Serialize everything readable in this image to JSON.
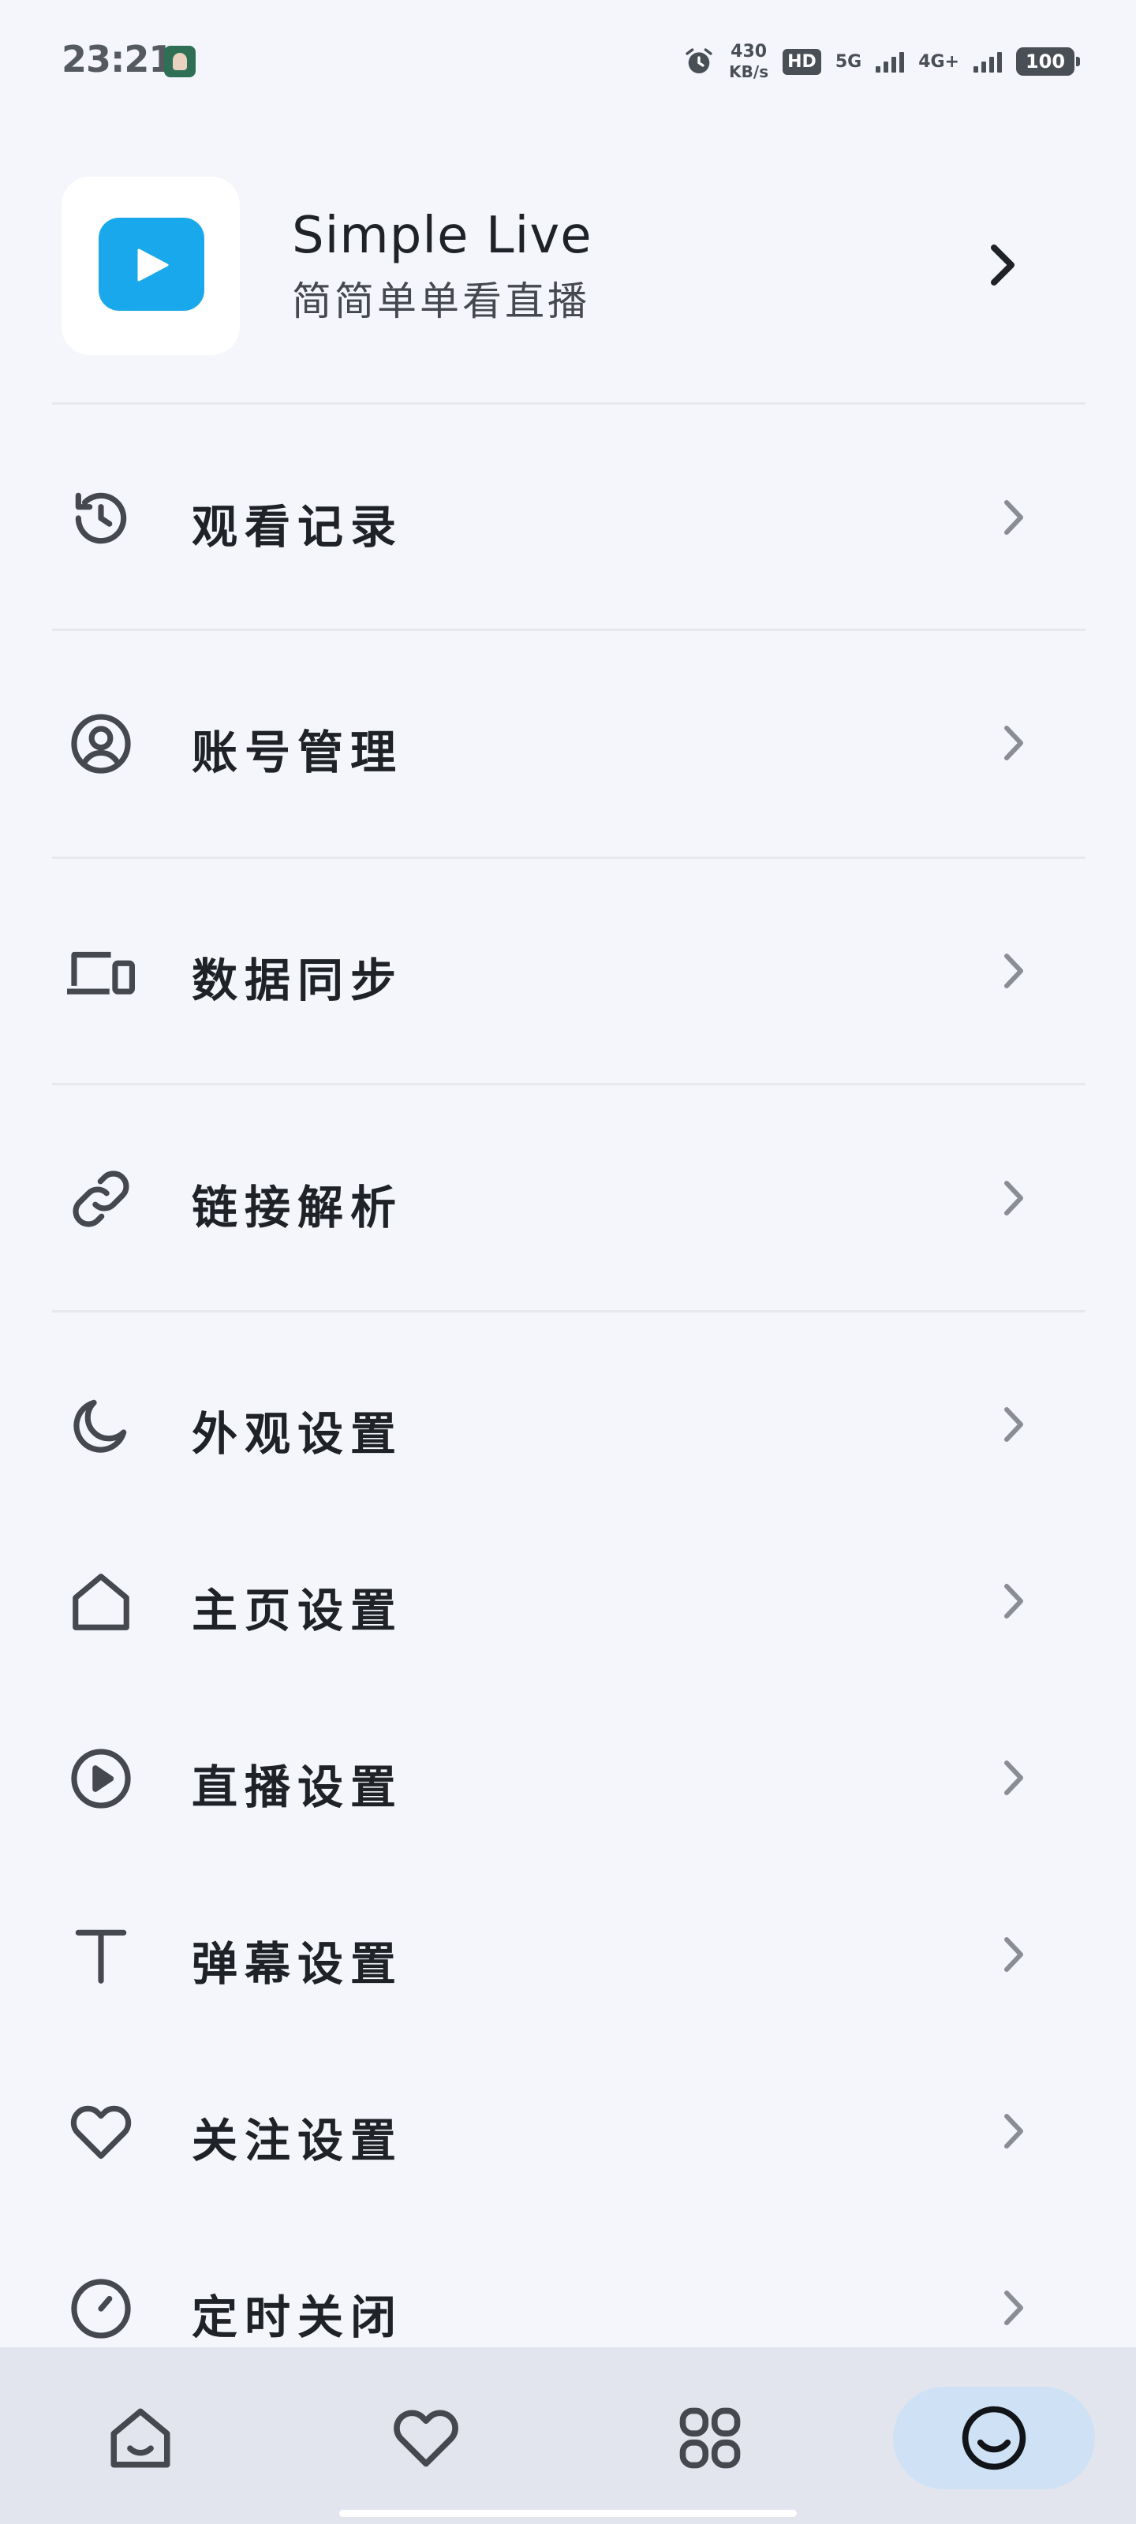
{
  "status_bar": {
    "time": "23:21",
    "net_speed_value": "430",
    "net_speed_unit": "KB/s",
    "hd_badge": "HD",
    "network_1": "5G",
    "network_2": "4G+",
    "battery": "100"
  },
  "app": {
    "name": "Simple Live",
    "subtitle": "简简单单看直播",
    "logo_color": "#1aa8ec"
  },
  "menu": [
    {
      "label": "观看记录",
      "icon": "history-icon"
    },
    {
      "label": "账号管理",
      "icon": "account-circle-icon"
    },
    {
      "label": "数据同步",
      "icon": "devices-icon"
    },
    {
      "label": "链接解析",
      "icon": "link-icon"
    },
    {
      "label": "外观设置",
      "icon": "moon-icon"
    },
    {
      "label": "主页设置",
      "icon": "home-icon"
    },
    {
      "label": "直播设置",
      "icon": "play-circle-icon"
    },
    {
      "label": "弹幕设置",
      "icon": "text-icon"
    },
    {
      "label": "关注设置",
      "icon": "heart-icon"
    },
    {
      "label": "定时关闭",
      "icon": "timer-icon"
    }
  ],
  "bottom_nav": [
    {
      "name": "home",
      "icon": "home-smile-icon",
      "active": false
    },
    {
      "name": "follow",
      "icon": "heart-icon",
      "active": false
    },
    {
      "name": "categories",
      "icon": "grid-icon",
      "active": false
    },
    {
      "name": "mine",
      "icon": "smiley-icon",
      "active": true
    }
  ],
  "colors": {
    "background": "#f4f6fb",
    "accent": "#1aa8ec",
    "nav_active": "#cfe1f5",
    "icon": "#45494f"
  }
}
